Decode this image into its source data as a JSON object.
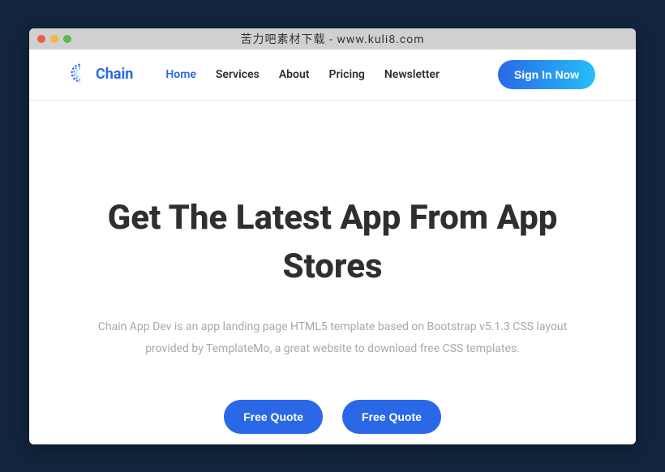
{
  "browser": {
    "title": "苦力吧素材下载 - www.kuli8.com"
  },
  "logo": {
    "text": "Chain"
  },
  "nav": {
    "items": [
      {
        "label": "Home",
        "active": true
      },
      {
        "label": "Services",
        "active": false
      },
      {
        "label": "About",
        "active": false
      },
      {
        "label": "Pricing",
        "active": false
      },
      {
        "label": "Newsletter",
        "active": false
      }
    ],
    "signin": "Sign In Now"
  },
  "hero": {
    "title": "Get The Latest App From App Stores",
    "description": "Chain App Dev is an app landing page HTML5 template based on Bootstrap v5.1.3 CSS layout provided by TemplateMo, a great website to download free CSS templates.",
    "button1": "Free Quote",
    "button2": "Free Quote"
  }
}
